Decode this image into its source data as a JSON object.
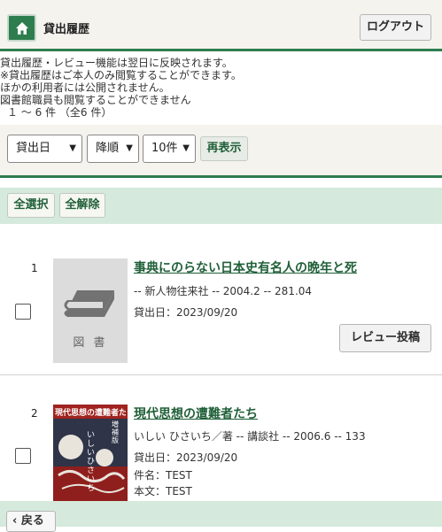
{
  "header": {
    "title": "貸出履歴",
    "logout_label": "ログアウト",
    "home_icon": "home-icon"
  },
  "notice": {
    "lines": [
      "貸出履歴・レビュー機能は翌日に反映されます。",
      "※貸出履歴はご本人のみ閲覧することができます。",
      "ほかの利用者には公開されません。",
      "図書館職員も閲覧することができません"
    ],
    "count": "１ ～ 6 件 （全6 件）"
  },
  "controls": {
    "sort_field": "貸出日",
    "sort_order": "降順",
    "per_page": "10件",
    "refresh_label": "再表示"
  },
  "bulk": {
    "select_all": "全選択",
    "deselect_all": "全解除"
  },
  "records": [
    {
      "number": "1",
      "title": "事典にのらない日本史有名人の晩年と死",
      "details": "-- 新人物往来社 -- 2004.2 -- 281.04",
      "loan_date": "貸出日：2023/09/20",
      "cover_label": "図 書",
      "review_label": "レビュー投稿"
    },
    {
      "number": "2",
      "title": "現代思想の遭難者たち",
      "details": "いしい ひさいち／著 -- 講談社 -- 2006.6 -- 133",
      "loan_date": "貸出日：2023/09/20",
      "subject": "件名：TEST",
      "body": "本文：TEST",
      "cover_art_text": "現代思想の遭難者たち",
      "cover_art_sub": "いしいひさいち",
      "cover_art_badge": "増補版"
    }
  ],
  "footer": {
    "back_label": "戻る"
  },
  "colors": {
    "accent": "#2e7d4f",
    "link": "#1f5f38",
    "band": "#d5eadd",
    "header_bg": "#f4f3ee"
  }
}
